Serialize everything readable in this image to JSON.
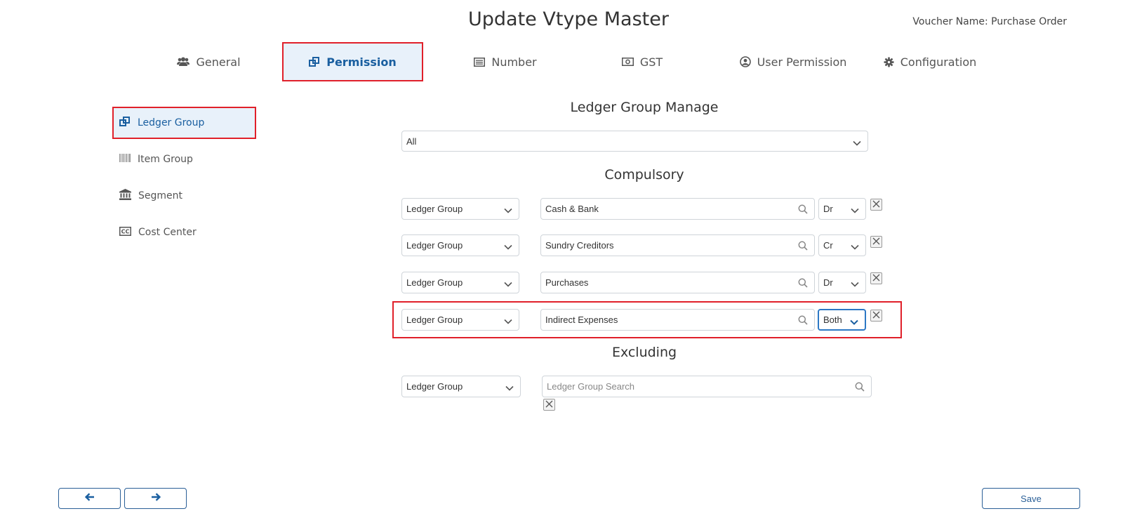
{
  "header": {
    "title": "Update Vtype Master",
    "voucher_name": "Voucher Name: Purchase Order"
  },
  "tabs": [
    {
      "label": "General",
      "icon": "users-icon",
      "active": false
    },
    {
      "label": "Permission",
      "icon": "clone-icon",
      "active": true
    },
    {
      "label": "Number",
      "icon": "list-icon",
      "active": false
    },
    {
      "label": "GST",
      "icon": "money-icon",
      "active": false
    },
    {
      "label": "User Permission",
      "icon": "user-circle-icon",
      "active": false
    },
    {
      "label": "Configuration",
      "icon": "gear-icon",
      "active": false
    }
  ],
  "sidebar": {
    "items": [
      {
        "label": "Ledger Group",
        "icon": "clone-icon",
        "active": true
      },
      {
        "label": "Item Group",
        "icon": "barcode-icon",
        "active": false
      },
      {
        "label": "Segment",
        "icon": "bank-icon",
        "active": false
      },
      {
        "label": "Cost Center",
        "icon": "cc-icon",
        "active": false
      }
    ]
  },
  "main": {
    "manage_title": "Ledger Group Manage",
    "manage_select": "All",
    "compulsory_title": "Compulsory",
    "compulsory_rows": [
      {
        "type": "Ledger Group",
        "value": "Cash & Bank",
        "side": "Dr"
      },
      {
        "type": "Ledger Group",
        "value": "Sundry Creditors",
        "side": "Cr"
      },
      {
        "type": "Ledger Group",
        "value": "Purchases",
        "side": "Dr"
      },
      {
        "type": "Ledger Group",
        "value": "Indirect Expenses",
        "side": "Both"
      }
    ],
    "excluding_title": "Excluding",
    "excluding_row": {
      "type": "Ledger Group",
      "placeholder": "Ledger Group Search"
    }
  },
  "footer": {
    "save_label": "Save"
  },
  "colors": {
    "accent": "#1a5fa0",
    "highlight_border": "#e0202a",
    "active_bg": "#e8f1fa"
  }
}
